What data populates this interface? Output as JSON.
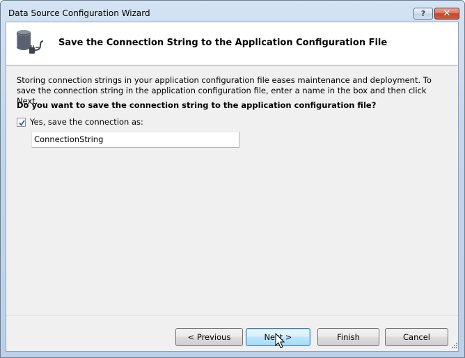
{
  "window": {
    "title": "Data Source Configuration Wizard",
    "help_label": "?",
    "close_label": "✕"
  },
  "header": {
    "title": "Save the Connection String to the Application Configuration File",
    "icon": "database-connection-icon"
  },
  "body": {
    "description": "Storing connection strings in your application configuration file eases maintenance and deployment. To save the connection string in the application configuration file, enter a name in the box and then click Next.",
    "question": "Do you want to save the connection string to the application configuration file?",
    "save_checkbox": {
      "label": "Yes, save the connection as:",
      "checked": true
    },
    "connection_name": {
      "value": "ConnectionString"
    }
  },
  "buttons": {
    "previous": "< Previous",
    "next": "Next >",
    "finish": "Finish",
    "cancel": "Cancel"
  },
  "colors": {
    "titlebar": "#c3d6eb",
    "client_bg": "#f0f0f0",
    "next_button_hover": "#bee6fd",
    "close_button": "#c4472c"
  }
}
